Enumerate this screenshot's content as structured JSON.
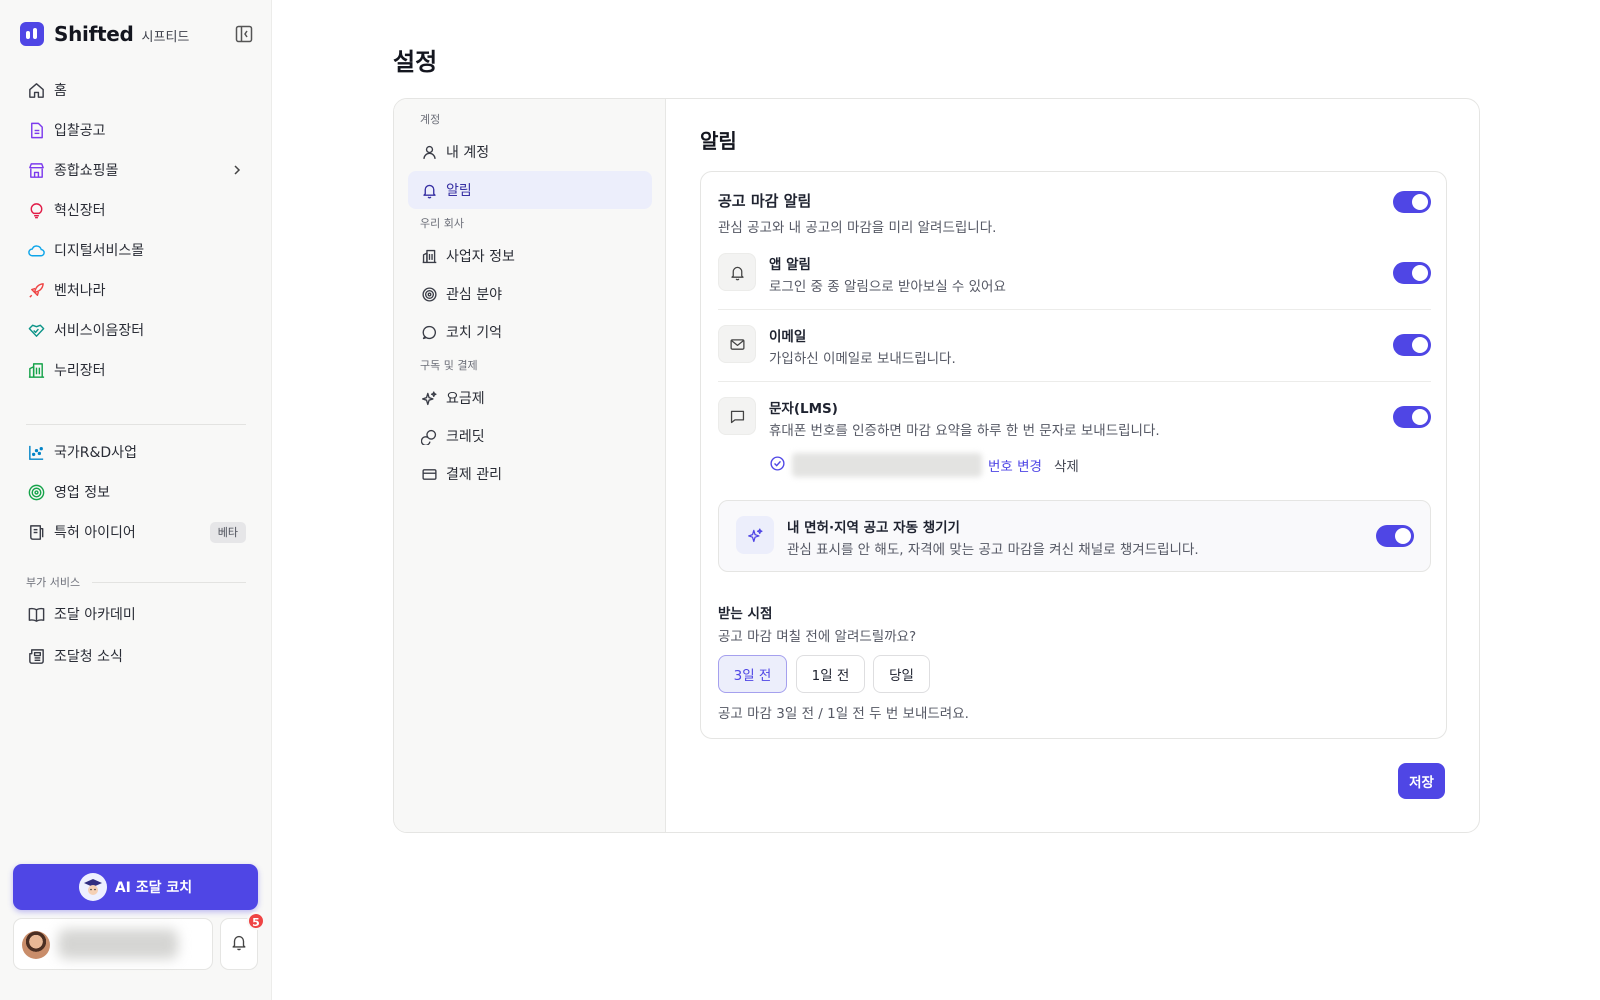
{
  "brand": {
    "name": "Shifted",
    "sub": "시프티드"
  },
  "sidebar": {
    "items": [
      {
        "label": "홈",
        "icon": "home-icon"
      },
      {
        "label": "입찰공고",
        "icon": "document-icon"
      },
      {
        "label": "종합쇼핑몰",
        "icon": "store-icon"
      },
      {
        "label": "혁신장터",
        "icon": "lightbulb-icon"
      },
      {
        "label": "디지털서비스몰",
        "icon": "cloud-icon"
      },
      {
        "label": "벤처나라",
        "icon": "rocket-icon"
      },
      {
        "label": "서비스이음장터",
        "icon": "handshake-icon"
      },
      {
        "label": "누리장터",
        "icon": "building-icon"
      }
    ],
    "items2": [
      {
        "label": "국가R&D사업",
        "icon": "scatter-chart-icon"
      },
      {
        "label": "영업 정보",
        "icon": "target-icon"
      },
      {
        "label": "특허 아이디어",
        "icon": "patent-icon",
        "badge": "베타"
      }
    ],
    "section_extra": "부가 서비스",
    "items3": [
      {
        "label": "조달 아카데미",
        "icon": "book-icon"
      },
      {
        "label": "조달청 소식",
        "icon": "newspaper-icon"
      }
    ],
    "coach_label": "AI 조달 코치",
    "notification_count": "5"
  },
  "colors": {
    "accent": "#4f46e5",
    "badge": "#ef4444"
  },
  "page": {
    "title": "설정"
  },
  "subnav": {
    "section_account": "계정",
    "my_account": "내 계정",
    "notifications": "알림",
    "section_company": "우리 회사",
    "business_info": "사업자 정보",
    "interests": "관심 분야",
    "coach_memory": "코치 기억",
    "section_billing": "구독 및 결제",
    "plans": "요금제",
    "credits": "크레딧",
    "payments": "결제 관리"
  },
  "alerts": {
    "section_title": "알림",
    "panel_title": "공고 마감 알림",
    "panel_desc": "관심 공고와 내 공고의 마감을 미리 알려드립니다.",
    "channels": [
      {
        "title": "앱 알림",
        "desc": "로그인 중 종 알림으로 받아보실 수 있어요",
        "enabled": true
      },
      {
        "title": "이메일",
        "desc": "가입하신 이메일로 보내드립니다.",
        "enabled": true
      },
      {
        "title": "문자(LMS)",
        "desc": "휴대폰 번호를 인증하면 마감 요약을 하루 한 번 문자로 보내드립니다.",
        "enabled": true
      }
    ],
    "phone_change": "번호 변경",
    "phone_delete": "삭제",
    "auto_title": "내 면허·지역 공고 자동 챙기기",
    "auto_desc": "관심 표시를 안 해도, 자격에 맞는 공고 마감을 켜신 채널로 챙겨드립니다.",
    "timing_title": "받는 시점",
    "timing_desc": "공고 마감 며칠 전에 알려드릴까요?",
    "timing_options": [
      "3일 전",
      "1일 전",
      "당일"
    ],
    "timing_selected": "3일 전",
    "timing_note": "공고 마감 3일 전 / 1일 전 두 번 보내드려요.",
    "save_label": "저장"
  }
}
